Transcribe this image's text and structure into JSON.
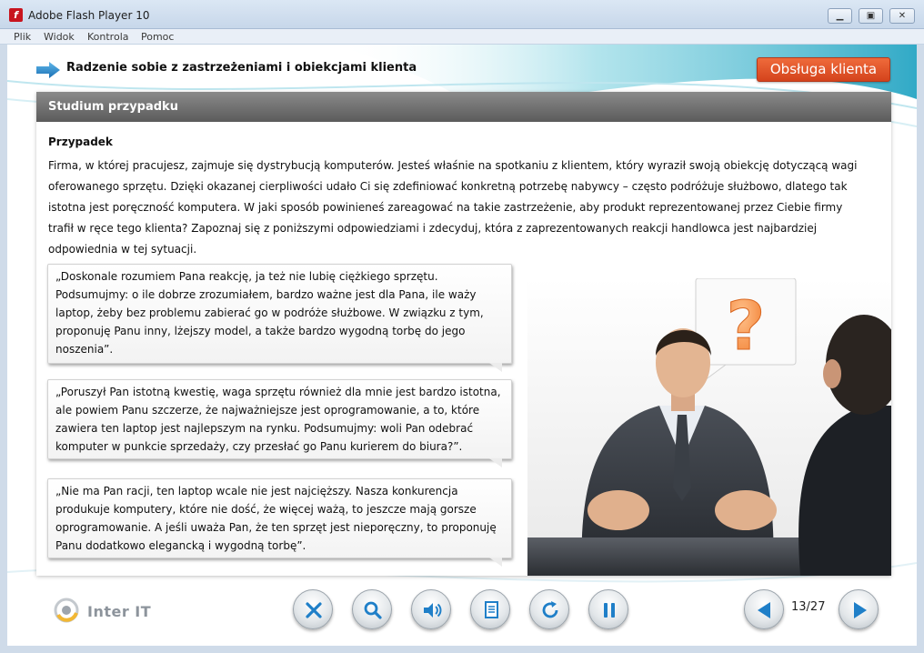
{
  "window": {
    "title": "Adobe Flash Player 10",
    "controls": [
      "minimize-icon",
      "maximize-icon",
      "close-icon"
    ]
  },
  "menu": {
    "items": [
      "Plik",
      "Widok",
      "Kontrola",
      "Pomoc"
    ]
  },
  "header": {
    "title": "Radzenie sobie z zastrzeżeniami i obiekcjami klienta",
    "category": "Obsługa klienta"
  },
  "panel": {
    "title": "Studium przypadku",
    "case_heading": "Przypadek",
    "case_lines": [
      "Firma, w której pracujesz, zajmuje się dystrybucją komputerów. Jesteś właśnie na spotkaniu z klientem, który wyraził swoją obiekcję dotyczącą wagi",
      "oferowanego sprzętu. Dzięki okazanej cierpliwości udało Ci się zdefiniować konkretną potrzebę nabywcy – często podróżuje służbowo, dlatego tak",
      "istotna jest poręczność komputera. W jaki sposób powinieneś zareagować na takie zastrzeżenie, aby produkt reprezentowanej przez Ciebie firmy",
      "trafił w ręce tego klienta? Zapoznaj się z poniższymi odpowiedziami i zdecyduj, która z zaprezentowanych reakcji handlowca jest najbardziej",
      "odpowiednia w tej sytuacji."
    ],
    "answers": [
      {
        "lines": [
          "„Doskonale rozumiem Pana reakcję, ja też nie lubię ciężkiego sprzętu.",
          "Podsumujmy: o ile dobrze zrozumiałem, bardzo ważne jest dla Pana, ile waży",
          "laptop, żeby bez problemu zabierać go w podróże służbowe. W związku z tym,",
          "proponuję Panu inny, lżejszy model, a także bardzo wygodną torbę do jego",
          "noszenia”."
        ]
      },
      {
        "lines": [
          "„Poruszył Pan istotną kwestię, waga sprzętu również dla mnie jest bardzo istotna,",
          "ale powiem Panu szczerze, że najważniejsze jest oprogramowanie, a to, które",
          "zawiera ten laptop jest najlepszym na rynku. Podsumujmy: woli Pan odebrać",
          "komputer w punkcie sprzedaży, czy przesłać go Panu kurierem do biura?”."
        ]
      },
      {
        "lines": [
          "„Nie ma Pan racji, ten laptop wcale nie jest najcięższy. Nasza konkurencja",
          "produkuje komputery, które nie dość, że więcej ważą, to jeszcze mają gorsze",
          "oprogramowanie. A jeśli uważa Pan, że ten sprzęt jest nieporęczny, to proponuję",
          "Panu dodatkowo elegancką i wygodną torbę”."
        ]
      }
    ],
    "illustration_symbol": "?"
  },
  "footer": {
    "logo_text": "Inter IT",
    "controls": [
      "close-x-icon",
      "search-icon",
      "audio-icon",
      "document-icon",
      "reload-icon",
      "pause-icon"
    ],
    "prev_icon": "arrow-left-icon",
    "next_icon": "arrow-right-icon",
    "page_counter": "13/27"
  },
  "colors": {
    "accent_orange": "#e2562a",
    "panel_header": "#6e6e6e",
    "nav_arrow": "#1f7fc8",
    "swoosh": "#3fb6cf"
  }
}
